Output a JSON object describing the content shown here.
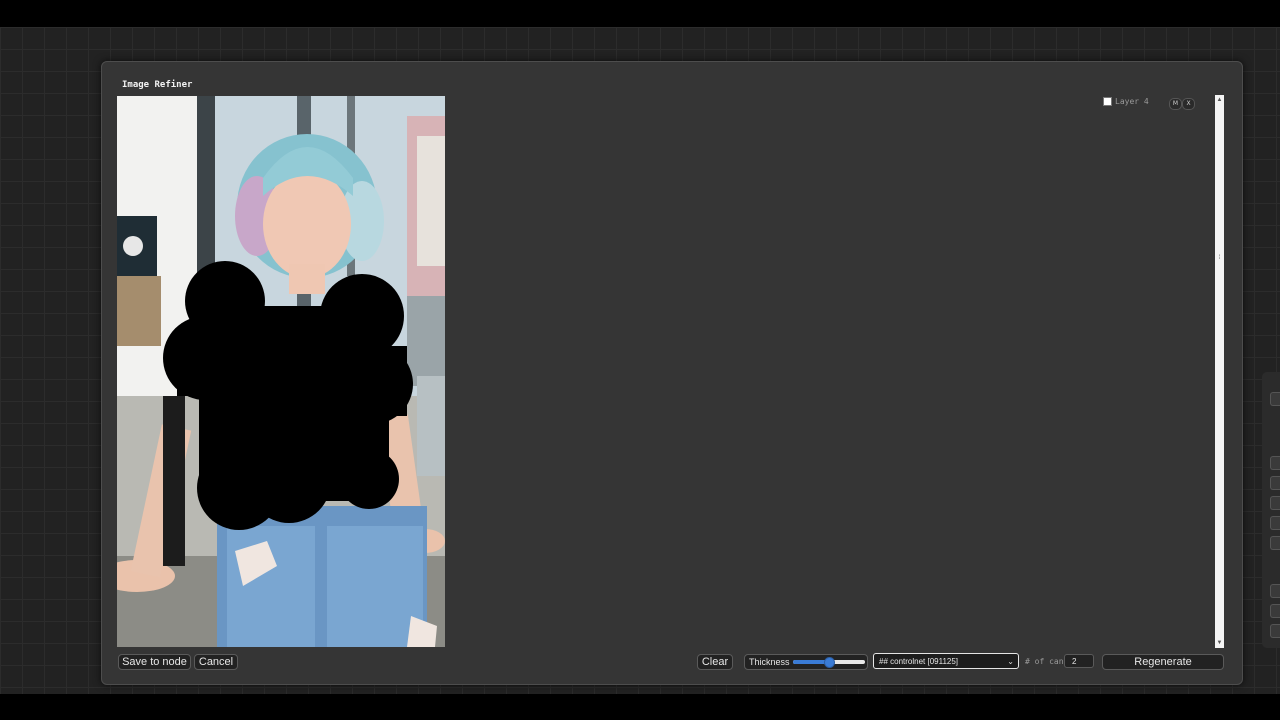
{
  "dialog": {
    "title": "Image Refiner"
  },
  "layer": {
    "label": "Layer 4",
    "checked": false,
    "m_label": "M",
    "x_label": "X"
  },
  "footer": {
    "save_label": "Save to node",
    "cancel_label": "Cancel",
    "clear_label": "Clear",
    "thickness_label": "Thickness",
    "thickness_value_fraction": 0.5,
    "preset_value": "## controlnet [091125]",
    "cand_label": "# of cand",
    "cand_value": "2",
    "regenerate_label": "Regenerate"
  },
  "colors": {
    "dialog_bg": "#353535",
    "slider_accent": "#3a7bd5",
    "mask": "#000000"
  },
  "icons": {
    "scroll_up": "scroll-up-arrow",
    "scroll_down": "scroll-down-arrow",
    "dropdown": "chevron-down"
  }
}
